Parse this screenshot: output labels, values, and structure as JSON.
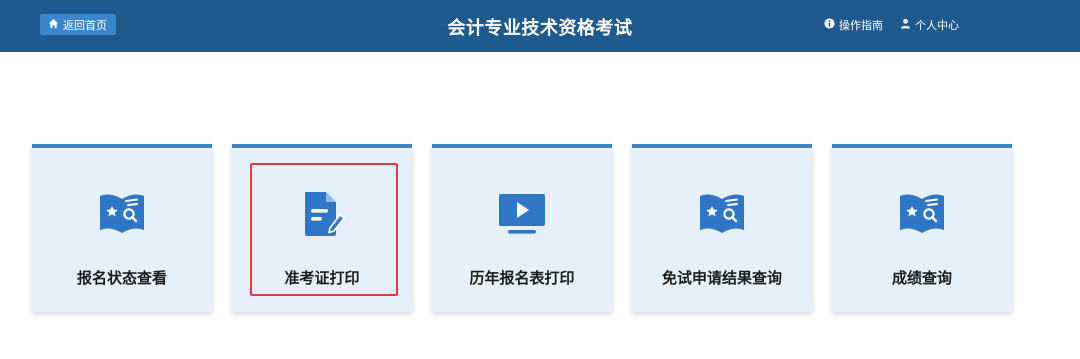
{
  "header": {
    "home_label": "返回首页",
    "title": "会计专业技术资格考试",
    "guide_label": "操作指南",
    "profile_label": "个人中心",
    "background_color": "#1f5a8f"
  },
  "cards": [
    {
      "label": "报名状态查看",
      "icon": "book-search-icon"
    },
    {
      "label": "准考证打印",
      "icon": "document-edit-icon",
      "highlighted": true
    },
    {
      "label": "历年报名表打印",
      "icon": "monitor-play-icon"
    },
    {
      "label": "免试申请结果查询",
      "icon": "book-search-icon"
    },
    {
      "label": "成绩查询",
      "icon": "book-search-icon"
    }
  ],
  "colors": {
    "card_background": "#e6f0fa",
    "card_accent": "#3b82c8",
    "icon_blue": "#2f77c6",
    "highlight": "#e23b3b"
  }
}
